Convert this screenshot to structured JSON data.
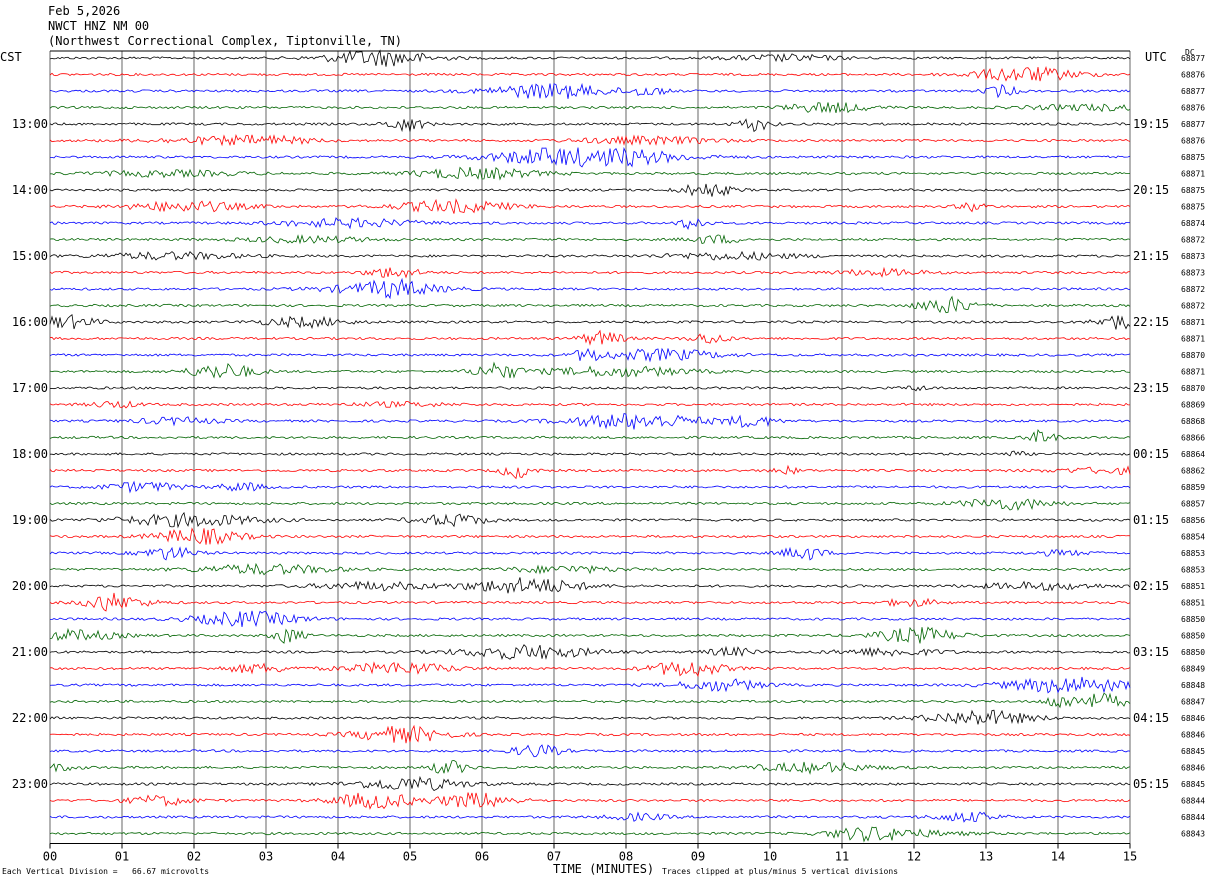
{
  "header": {
    "date": "Feb 5,2026",
    "station": "NWCT HNZ NM 00",
    "location": "(Northwest Correctional Complex, Tiptonville, TN)"
  },
  "labels": {
    "left_tz": "CST",
    "right_tz": "UTC",
    "dc_header": "DC",
    "x_axis_label": "TIME (MINUTES)",
    "footer_left": "Each Vertical Division =   66.67 microvolts",
    "footer_right": "Traces clipped at plus/minus 5 vertical divisions"
  },
  "colors": {
    "trace_cycle": [
      "#000000",
      "#ff0000",
      "#0000ff",
      "#006400"
    ],
    "grid": "#000000"
  },
  "chart_data": {
    "type": "line",
    "title": "NWCT HNZ NM 00",
    "xlabel": "TIME (MINUTES)",
    "xlim": [
      0,
      15
    ],
    "x_ticks": [
      "00",
      "01",
      "02",
      "03",
      "04",
      "05",
      "06",
      "07",
      "08",
      "09",
      "10",
      "11",
      "12",
      "13",
      "14",
      "15"
    ],
    "traces_per_hour": 4,
    "minutes_per_trace": 15,
    "left_time_labels": [
      "13:00",
      "14:00",
      "15:00",
      "16:00",
      "17:00",
      "18:00",
      "19:00",
      "20:00",
      "21:00",
      "22:00",
      "23:00"
    ],
    "right_time_labels": [
      "19:15",
      "20:15",
      "21:15",
      "22:15",
      "23:15",
      "00:15",
      "01:15",
      "02:15",
      "03:15",
      "04:15",
      "05:15"
    ],
    "dc_offsets": [
      "68877",
      "68876",
      "68877",
      "68876",
      "68877",
      "68876",
      "68875",
      "68871",
      "68875",
      "68875",
      "68874",
      "68872",
      "68873",
      "68873",
      "68872",
      "68872",
      "68871",
      "68871",
      "68870",
      "68871",
      "68870",
      "68869",
      "68868",
      "68866",
      "68864",
      "68862",
      "68859",
      "68857",
      "68856",
      "68854",
      "68853",
      "68853",
      "68851",
      "68851",
      "68850",
      "68850",
      "68850",
      "68849",
      "68848",
      "68847",
      "68846",
      "68846",
      "68845",
      "68846",
      "68845",
      "68844",
      "68844",
      "68843"
    ],
    "microvolts_per_division": "66.67",
    "clip_divisions": 5
  }
}
